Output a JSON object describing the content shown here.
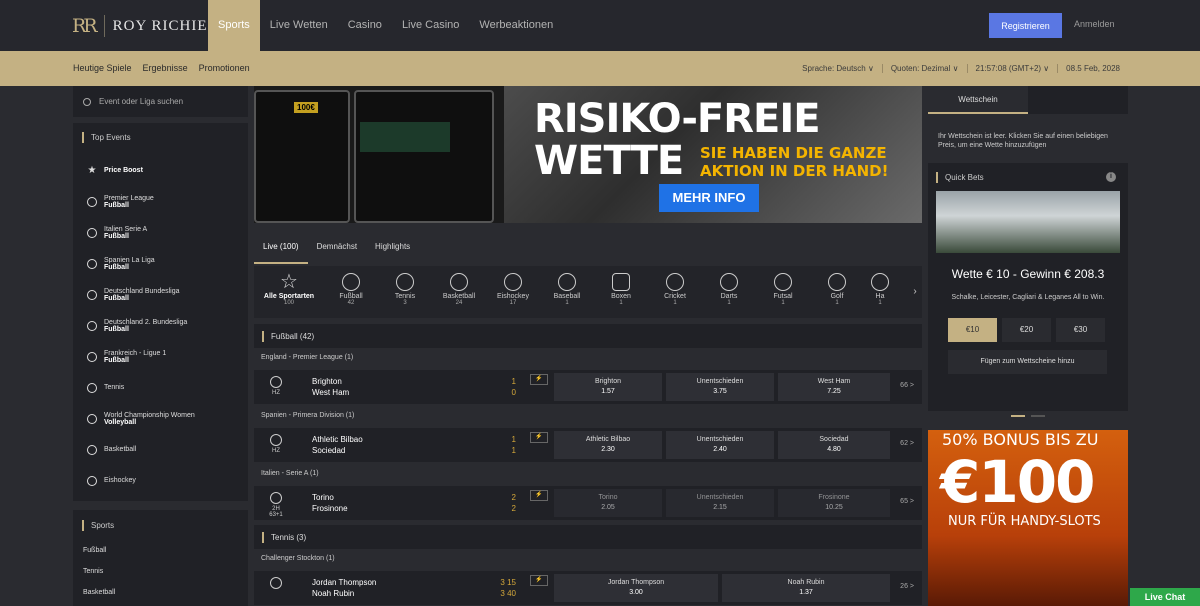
{
  "brand": {
    "mark": "RR",
    "name": "ROY RICHIE"
  },
  "nav": [
    "Sports",
    "Live Wetten",
    "Casino",
    "Live Casino",
    "Werbeaktionen"
  ],
  "auth": {
    "register": "Registrieren",
    "login": "Anmelden"
  },
  "subnav": [
    "Heutige Spiele",
    "Ergebnisse",
    "Promotionen"
  ],
  "subright": [
    "Sprache: Deutsch ∨",
    "Quoten: Dezimal ∨",
    "21:57:08 (GMT+2) ∨",
    "08.5 Feb, 2028"
  ],
  "search_placeholder": "Event oder Liga suchen",
  "top_events": {
    "title": "Top Events",
    "items": [
      {
        "l1": "Price Boost",
        "l2": ""
      },
      {
        "l1": "Premier League",
        "l2": "Fußball"
      },
      {
        "l1": "Italien Serie A",
        "l2": "Fußball"
      },
      {
        "l1": "Spanien La Liga",
        "l2": "Fußball"
      },
      {
        "l1": "Deutschland Bundesliga",
        "l2": "Fußball"
      },
      {
        "l1": "Deutschland 2. Bundesliga",
        "l2": "Fußball"
      },
      {
        "l1": "Frankreich - Ligue 1",
        "l2": "Fußball"
      },
      {
        "l1": "Tennis",
        "l2": ""
      },
      {
        "l1": "World Championship Women",
        "l2": "Volleyball"
      },
      {
        "l1": "Basketball",
        "l2": ""
      },
      {
        "l1": "Eishockey",
        "l2": ""
      }
    ]
  },
  "sports_menu": {
    "title": "Sports",
    "items": [
      "Fußball",
      "Tennis",
      "Basketball"
    ]
  },
  "banner": {
    "title_line1": "RISIKO-FREIE",
    "title_line2": "WETTE",
    "sub_line1": "SIE HABEN DIE GANZE",
    "sub_line2": "AKTION IN DER HAND!",
    "button": "MEHR INFO",
    "phone_label": "100€"
  },
  "tabs": [
    "Live (100)",
    "Demnächst",
    "Highlights"
  ],
  "sports_strip": [
    {
      "label": "Alle Sportarten",
      "count": "100"
    },
    {
      "label": "Fußball",
      "count": "42"
    },
    {
      "label": "Tennis",
      "count": "3"
    },
    {
      "label": "Basketball",
      "count": "24"
    },
    {
      "label": "Eishockey",
      "count": "17"
    },
    {
      "label": "Baseball",
      "count": "1"
    },
    {
      "label": "Boxen",
      "count": "1"
    },
    {
      "label": "Cricket",
      "count": "1"
    },
    {
      "label": "Darts",
      "count": "1"
    },
    {
      "label": "Futsal",
      "count": "1"
    },
    {
      "label": "Golf",
      "count": "1"
    },
    {
      "label": "Ha",
      "count": "1"
    }
  ],
  "sections": {
    "football": "Fußball (42)",
    "tennis": "Tennis (3)"
  },
  "leagues": {
    "epl": "England - Premier League (1)",
    "laliga": "Spanien - Primera Division (1)",
    "seriea": "Italien - Serie A (1)",
    "stockton": "Challenger Stockton (1)"
  },
  "matches": [
    {
      "period": "HZ",
      "home": "Brighton",
      "away": "West Ham",
      "hs": "1",
      "as": "0",
      "o1n": "Brighton",
      "o1v": "1.57",
      "oxn": "Unentschieden",
      "oxv": "3.75",
      "o2n": "West Ham",
      "o2v": "7.25",
      "more": "66 >"
    },
    {
      "period": "HZ",
      "home": "Athletic Bilbao",
      "away": "Sociedad",
      "hs": "1",
      "as": "1",
      "o1n": "Athletic Bilbao",
      "o1v": "2.30",
      "oxn": "Unentschieden",
      "oxv": "2.40",
      "o2n": "Sociedad",
      "o2v": "4.80",
      "more": "62 >"
    },
    {
      "period": "2H 63+1",
      "home": "Torino",
      "away": "Frosinone",
      "hs": "2",
      "as": "2",
      "o1n": "Torino",
      "o1v": "2.05",
      "oxn": "Unentschieden",
      "oxv": "2.15",
      "o2n": "Frosinone",
      "o2v": "10.25",
      "more": "65 >"
    },
    {
      "period": "",
      "home": "Jordan Thompson",
      "away": "Noah Rubin",
      "hs": "3 15",
      "as": "3 40",
      "o1n": "Jordan Thompson",
      "o1v": "3.00",
      "o2n": "Noah Rubin",
      "o2v": "1.37",
      "more": "26 >"
    }
  ],
  "wettschein": {
    "tab": "Wettschein",
    "empty": "Ihr Wettschein ist leer. Klicken Sie auf einen beliebigen Preis, um eine Wette hinzuzufügen"
  },
  "quickbets": {
    "title": "Quick Bets",
    "headline": "Wette € 10 - Gewinn € 208.3",
    "desc": "Schalke, Leicester, Cagliari & Leganes All to Win.",
    "stakes": [
      "€10",
      "€20",
      "€30"
    ],
    "add": "Fügen zum Wettscheine hinzu"
  },
  "promo": {
    "line1": "50% BONUS BIS ZU",
    "line2": "€100",
    "line3": "NUR FÜR HANDY-SLOTS"
  },
  "livechat": "Live Chat"
}
